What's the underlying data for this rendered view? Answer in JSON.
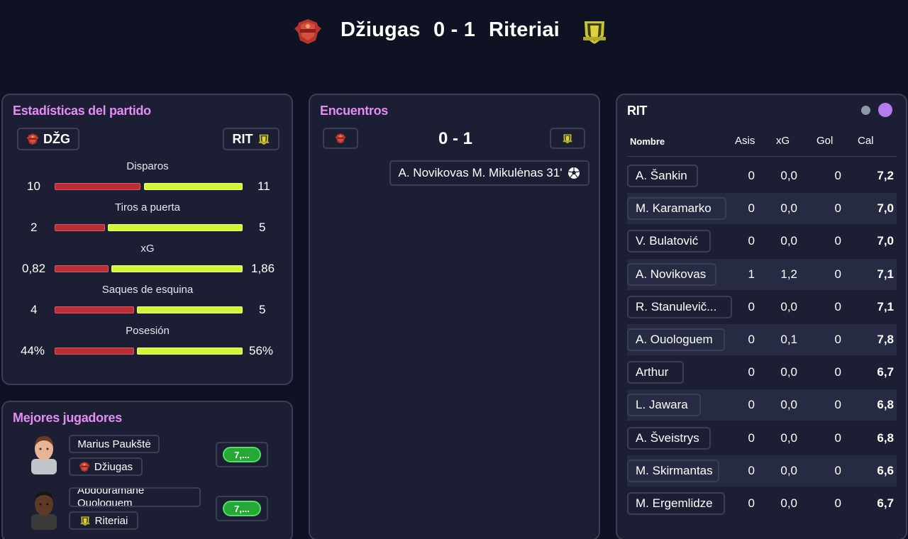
{
  "match": {
    "home_team": "Džiugas",
    "score": "0 - 1",
    "away_team": "Riteriai",
    "home_short": "DŽG",
    "away_short": "RIT",
    "home_color": "#c8372d",
    "away_color": "#d9d43a"
  },
  "stats_panel": {
    "title": "Estadísticas del partido",
    "rows": [
      {
        "label": "Disparos",
        "home": "10",
        "away": "11"
      },
      {
        "label": "Tiros a puerta",
        "home": "2",
        "away": "5"
      },
      {
        "label": "xG",
        "home": "0,82",
        "away": "1,86"
      },
      {
        "label": "Saques de esquina",
        "home": "4",
        "away": "5"
      },
      {
        "label": "Posesión",
        "home": "44%",
        "away": "56%"
      }
    ]
  },
  "events_panel": {
    "title": "Encuentros",
    "score": "0 - 1",
    "event": "A. Novikovas M. Mikulėnas 31'",
    "event_icon": "football-icon"
  },
  "best_players": {
    "title": "Mejores jugadores",
    "players": [
      {
        "name": "Marius Paukštė",
        "team": "Džiugas",
        "rating": "7,..."
      },
      {
        "name": "Abdouramane Ouologuem",
        "team": "Riteriai",
        "rating": "7,..."
      }
    ]
  },
  "lineup_panel": {
    "title": "RIT",
    "columns": [
      "Nombre",
      "Asis",
      "xG",
      "Gol",
      "Cal"
    ],
    "toggle_colors": [
      "#8c9aa6",
      "#b57cf0"
    ],
    "players": [
      {
        "name": "A. Šankin",
        "asis": "0",
        "xg": "0,0",
        "gol": "0",
        "cal": "7,2"
      },
      {
        "name": "M. Karamarko",
        "asis": "0",
        "xg": "0,0",
        "gol": "0",
        "cal": "7,0"
      },
      {
        "name": "V. Bulatović",
        "asis": "0",
        "xg": "0,0",
        "gol": "0",
        "cal": "7,0"
      },
      {
        "name": "A. Novikovas",
        "asis": "1",
        "xg": "1,2",
        "gol": "0",
        "cal": "7,1"
      },
      {
        "name": "R. Stanulevič...",
        "asis": "0",
        "xg": "0,0",
        "gol": "0",
        "cal": "7,1"
      },
      {
        "name": "A. Ouologuem",
        "asis": "0",
        "xg": "0,1",
        "gol": "0",
        "cal": "7,8"
      },
      {
        "name": "Arthur",
        "asis": "0",
        "xg": "0,0",
        "gol": "0",
        "cal": "6,7"
      },
      {
        "name": "L. Jawara",
        "asis": "0",
        "xg": "0,0",
        "gol": "0",
        "cal": "6,8"
      },
      {
        "name": "A. Šveistrys",
        "asis": "0",
        "xg": "0,0",
        "gol": "0",
        "cal": "6,8"
      },
      {
        "name": "M. Skirmantas",
        "asis": "0",
        "xg": "0,0",
        "gol": "0",
        "cal": "6,6"
      },
      {
        "name": "M. Ergemlidze",
        "asis": "0",
        "xg": "0,0",
        "gol": "0",
        "cal": "6,7"
      }
    ]
  }
}
